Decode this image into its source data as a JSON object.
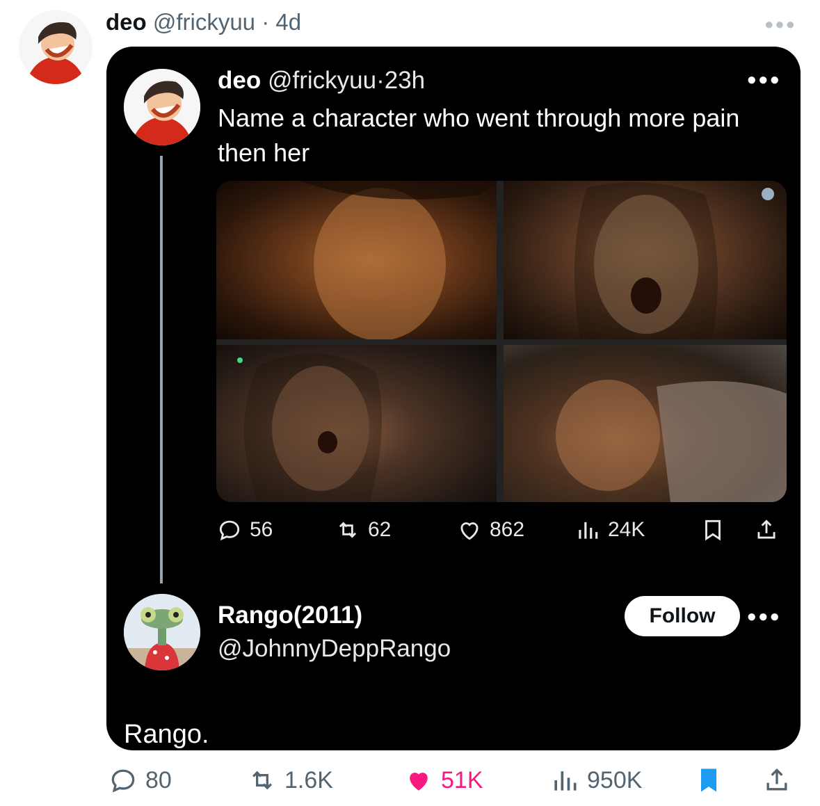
{
  "outer_post": {
    "display_name": "deo",
    "handle": "@frickyuu",
    "separator": "·",
    "time": "4d",
    "reply_text": "Rango.",
    "stats": {
      "replies": "80",
      "reposts": "1.6K",
      "likes": "51K",
      "views": "950K"
    }
  },
  "quoted_post": {
    "display_name": "deo",
    "handle": "@frickyuu",
    "separator": "·",
    "time": "23h",
    "text": "Name a character who went through more pain then her",
    "stats": {
      "replies": "56",
      "reposts": "62",
      "likes": "862",
      "views": "24K"
    }
  },
  "reply_account": {
    "display_name": "Rango(2011)",
    "handle": "@JohnnyDeppRango",
    "follow_label": "Follow"
  },
  "colors": {
    "like_active": "#f91880",
    "bookmark_active": "#1d9bf0"
  },
  "icons": [
    "more-icon",
    "reply-icon",
    "repost-icon",
    "like-icon",
    "views-icon",
    "bookmark-icon",
    "share-icon"
  ]
}
